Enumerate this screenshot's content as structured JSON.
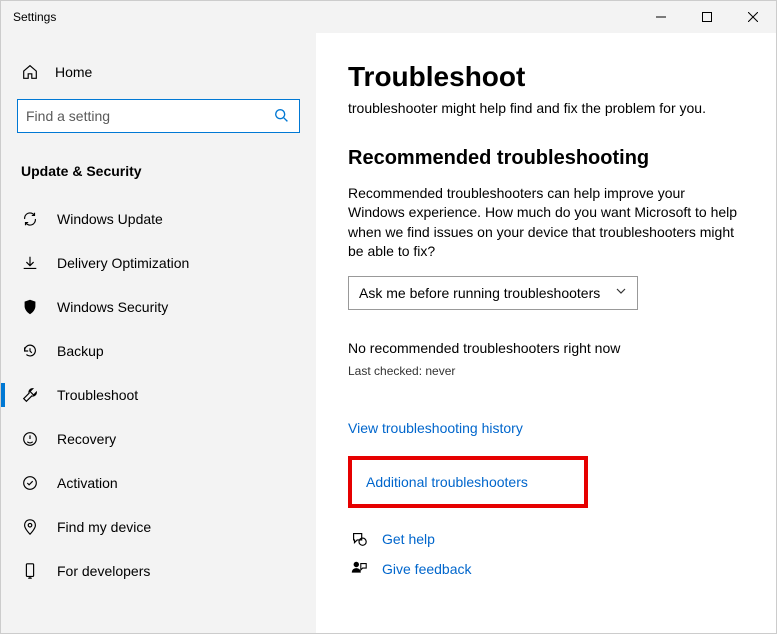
{
  "window": {
    "title": "Settings"
  },
  "sidebar": {
    "home_label": "Home",
    "search_placeholder": "Find a setting",
    "category": "Update & Security",
    "items": [
      {
        "label": "Windows Update"
      },
      {
        "label": "Delivery Optimization"
      },
      {
        "label": "Windows Security"
      },
      {
        "label": "Backup"
      },
      {
        "label": "Troubleshoot"
      },
      {
        "label": "Recovery"
      },
      {
        "label": "Activation"
      },
      {
        "label": "Find my device"
      },
      {
        "label": "For developers"
      }
    ]
  },
  "main": {
    "title": "Troubleshoot",
    "intro": "troubleshooter might help find and fix the problem for you.",
    "section_title": "Recommended troubleshooting",
    "section_body": "Recommended troubleshooters can help improve your Windows experience. How much do you want Microsoft to help when we find issues on your device that troubleshooters might be able to fix?",
    "select_value": "Ask me before running troubleshooters",
    "status": "No recommended troubleshooters right now",
    "last_checked": "Last checked: never",
    "link_history": "View troubleshooting history",
    "link_additional": "Additional troubleshooters",
    "link_help": "Get help",
    "link_feedback": "Give feedback"
  }
}
